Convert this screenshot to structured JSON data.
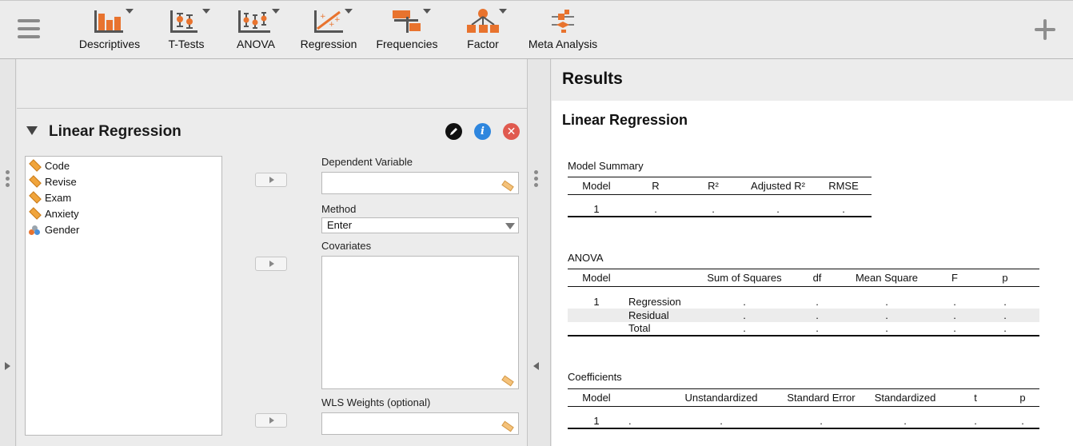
{
  "ribbon": {
    "modules": [
      {
        "label": "Descriptives",
        "icon": "descriptives-icon"
      },
      {
        "label": "T-Tests",
        "icon": "t-tests-icon"
      },
      {
        "label": "ANOVA",
        "icon": "anova-icon"
      },
      {
        "label": "Regression",
        "icon": "regression-icon"
      },
      {
        "label": "Frequencies",
        "icon": "frequencies-icon"
      },
      {
        "label": "Factor",
        "icon": "factor-icon"
      },
      {
        "label": "Meta Analysis",
        "icon": "meta-analysis-icon"
      }
    ],
    "accent": "#e8732e"
  },
  "analysis": {
    "title": "Linear Regression",
    "variables": [
      {
        "name": "Code",
        "type": "scale"
      },
      {
        "name": "Revise",
        "type": "scale"
      },
      {
        "name": "Exam",
        "type": "scale"
      },
      {
        "name": "Anxiety",
        "type": "scale"
      },
      {
        "name": "Gender",
        "type": "nominal"
      }
    ],
    "dependent_label": "Dependent Variable",
    "method_label": "Method",
    "method_value": "Enter",
    "covariates_label": "Covariates",
    "wls_label": "WLS Weights (optional)"
  },
  "results": {
    "title": "Results",
    "analysis_title": "Linear Regression",
    "model_summary": {
      "caption": "Model Summary",
      "headers": [
        "Model",
        "R",
        "R²",
        "Adjusted R²",
        "RMSE"
      ],
      "rows": [
        [
          "1",
          ".",
          ".",
          ".",
          "."
        ]
      ]
    },
    "anova": {
      "caption": "ANOVA",
      "headers": [
        "Model",
        "",
        "Sum of Squares",
        "df",
        "Mean Square",
        "F",
        "p"
      ],
      "rows": [
        [
          "1",
          "Regression",
          ".",
          ".",
          ".",
          ".",
          "."
        ],
        [
          "",
          "Residual",
          ".",
          ".",
          ".",
          ".",
          "."
        ],
        [
          "",
          "Total",
          ".",
          ".",
          ".",
          ".",
          "."
        ]
      ]
    },
    "coefficients": {
      "caption": "Coefficients",
      "headers": [
        "Model",
        "",
        "Unstandardized",
        "Standard Error",
        "Standardized",
        "t",
        "p"
      ],
      "rows": [
        [
          "1",
          ".",
          ".",
          ".",
          ".",
          ".",
          "."
        ]
      ]
    }
  }
}
